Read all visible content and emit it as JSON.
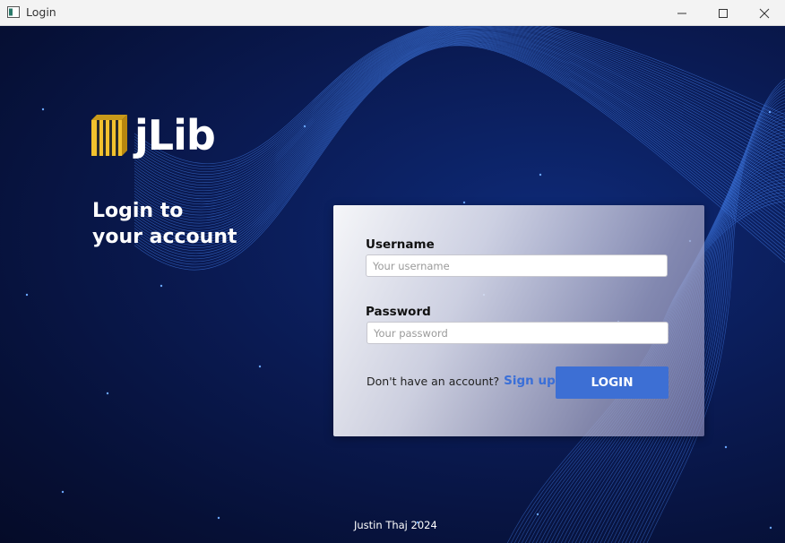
{
  "window": {
    "title": "Login",
    "icons": {
      "app": "window-app-icon",
      "minimize": "minimize-icon",
      "maximize": "maximize-icon",
      "close": "close-icon"
    }
  },
  "logo": {
    "text": "jLib",
    "icon": "books-icon",
    "icon_color": "#f2c12e"
  },
  "heading": {
    "line1": "Login to",
    "line2": "your account"
  },
  "form": {
    "username": {
      "label": "Username",
      "placeholder": "Your username",
      "value": ""
    },
    "password": {
      "label": "Password",
      "placeholder": "Your password",
      "value": ""
    },
    "signup_prompt": "Don't have an account?",
    "signup_link": "Sign up",
    "login_button": "LOGIN"
  },
  "footer": {
    "text": "Justin Thaj 2024"
  },
  "colors": {
    "accent": "#3d6fd4",
    "link": "#3a6fd8",
    "background": "#0a1a52",
    "wave": "#4a8cff"
  }
}
